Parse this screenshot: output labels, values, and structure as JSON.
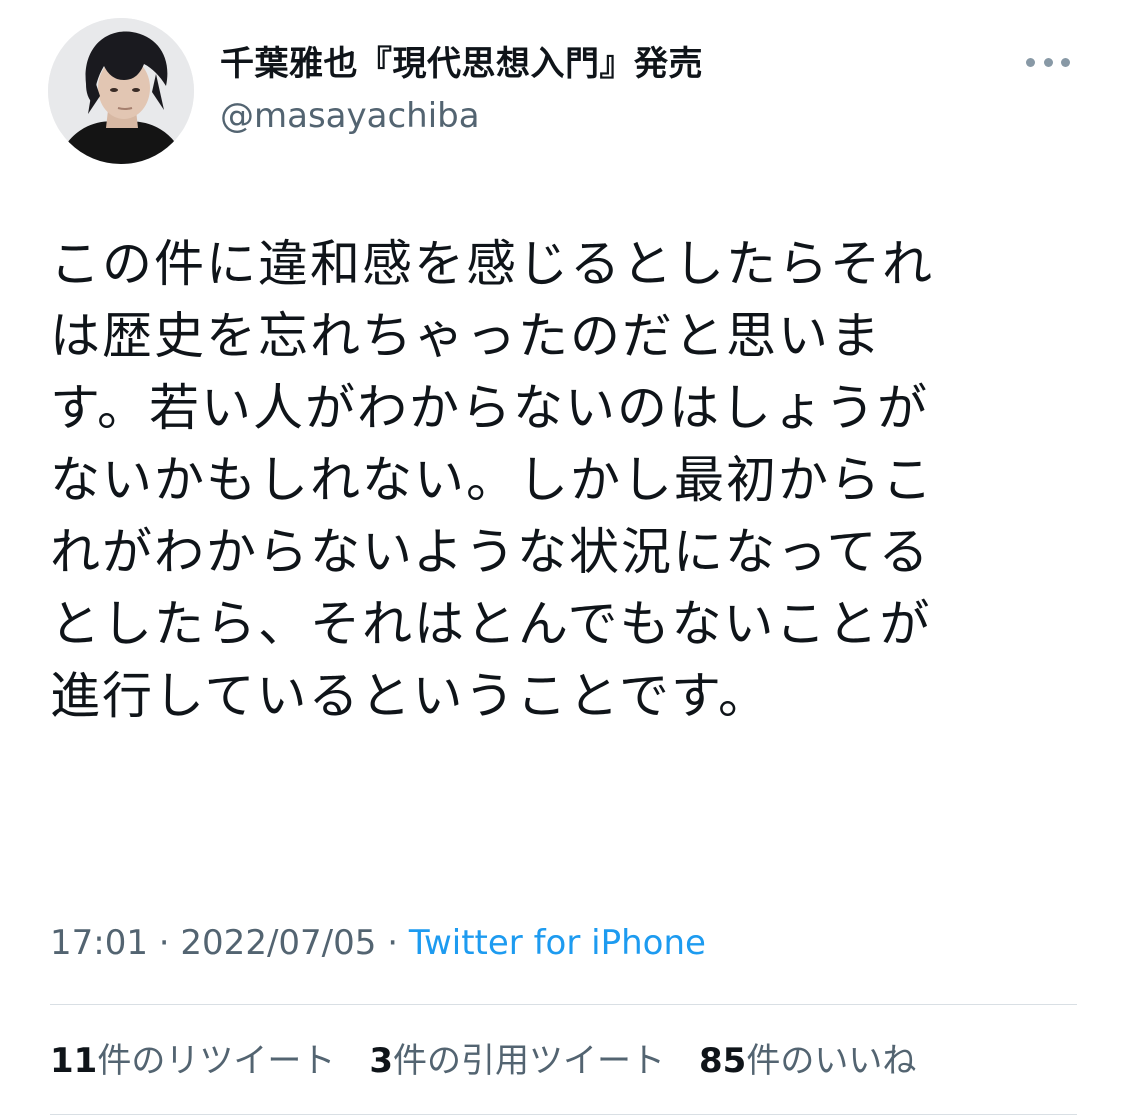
{
  "user": {
    "display_name": "千葉雅也『現代思想入門』発売",
    "handle": "@masayachiba",
    "avatar_icon": "user-avatar-photo"
  },
  "more_icon": "more-dots-icon",
  "tweet": {
    "text": "この件に違和感を感じるとしたらそれ\nは歴史を忘れちゃったのだと思いま\nす。若い人がわからないのはしょうが\nないかもしれない。しかし最初からこ\nれがわからないような状況になってる\nとしたら、それはとんでもないことが\n進行しているということです。",
    "time": "17:01",
    "date": "2022/07/05",
    "separator": "·",
    "source": "Twitter for iPhone"
  },
  "stats": {
    "retweets_count": "11",
    "retweets_label": "件のリツイート",
    "quotes_count": "3",
    "quotes_label": "件の引用ツイート",
    "likes_count": "85",
    "likes_label": "件のいいね"
  },
  "colors": {
    "text": "#0f1419",
    "secondary": "#536471",
    "link": "#1d9bf0",
    "divider": "#d9dfe4"
  }
}
